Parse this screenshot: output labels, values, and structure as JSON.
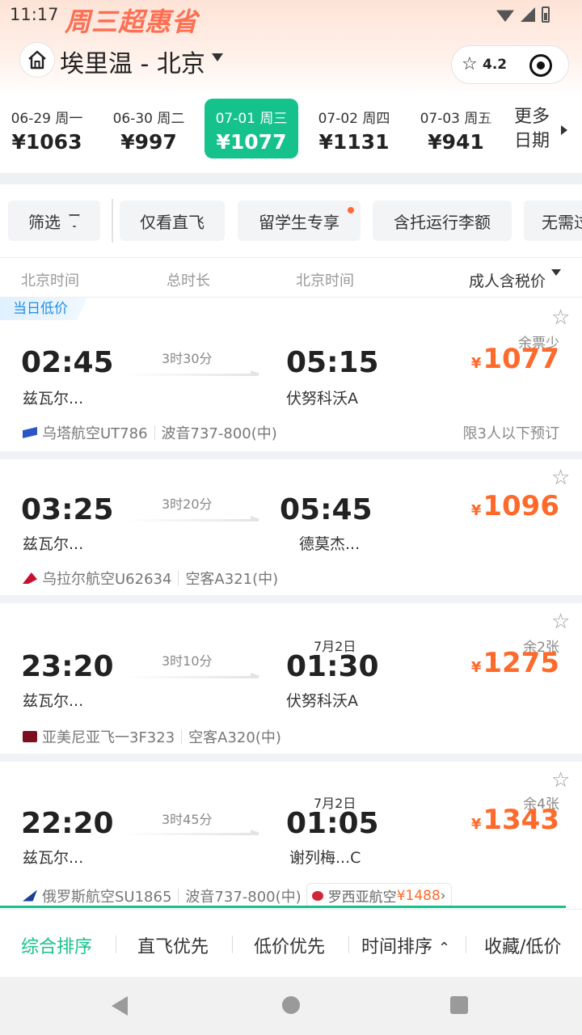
{
  "status": {
    "time": "11:17",
    "extra": "≠"
  },
  "promo": {
    "label": "周三超惠省"
  },
  "header": {
    "route": "埃里温 - 北京",
    "rating": "4.2"
  },
  "dates": [
    {
      "date": "06-29 周一",
      "price": "¥1063",
      "active": false
    },
    {
      "date": "06-30 周二",
      "price": "¥997",
      "active": false
    },
    {
      "date": "07-01 周三",
      "price": "¥1077",
      "active": true
    },
    {
      "date": "07-02 周四",
      "price": "¥1131",
      "active": false
    },
    {
      "date": "07-03 周五",
      "price": "¥941",
      "active": false
    }
  ],
  "more_dates": {
    "line1": "更多",
    "line2": "日期"
  },
  "filters": {
    "filter": "筛选",
    "direct": "仅看直飞",
    "student": "留学生专享",
    "baggage": "含托运行李额",
    "novisa": "无需过境签"
  },
  "columns": {
    "dep": "北京时间",
    "dur": "总时长",
    "arr": "北京时间",
    "price_sort": "成人含税价"
  },
  "flights": [
    {
      "tag": "当日低价",
      "dep_time": "02:45",
      "dep_airport": "兹瓦尔...",
      "duration": "3时30分",
      "arr_time": "05:15",
      "arr_day": "",
      "arr_airport": "伏努科沃A",
      "currency": "¥",
      "price": "1077",
      "remain": "余票少",
      "airline": "乌塔航空UT786",
      "aircraft": "波音737-800(中)",
      "note": "限3人以下预订",
      "logo_color": "#2a57c6"
    },
    {
      "tag": "",
      "dep_time": "03:25",
      "dep_airport": "兹瓦尔...",
      "duration": "3时20分",
      "arr_time": "05:45",
      "arr_day": "",
      "arr_airport": "德莫杰...",
      "currency": "¥",
      "price": "1096",
      "remain": "",
      "airline": "乌拉尔航空U62634",
      "aircraft": "空客A321(中)",
      "note": "",
      "logo_color": "#c8102e"
    },
    {
      "tag": "",
      "dep_time": "23:20",
      "dep_airport": "兹瓦尔...",
      "duration": "3时10分",
      "arr_time": "01:30",
      "arr_day": "7月2日",
      "arr_airport": "伏努科沃A",
      "currency": "¥",
      "price": "1275",
      "remain": "余2张",
      "airline": "亚美尼亚飞一3F323",
      "aircraft": "空客A320(中)",
      "note": "",
      "logo_color": "#7a1020"
    },
    {
      "tag": "",
      "dep_time": "22:20",
      "dep_airport": "兹瓦尔...",
      "duration": "3时45分",
      "arr_time": "01:05",
      "arr_day": "7月2日",
      "arr_airport": "谢列梅...C",
      "currency": "¥",
      "price": "1343",
      "remain": "余4张",
      "airline": "俄罗斯航空SU1865",
      "aircraft": "波音737-800(中)",
      "share_airline": "罗西亚航空",
      "share_price": "¥1488",
      "note": "",
      "logo_color": "#1b3f95"
    }
  ],
  "sortbar": {
    "comprehensive": "综合排序",
    "direct_first": "直飞优先",
    "low_price": "低价优先",
    "time_sort": "时间排序",
    "fav_low": "收藏/低价"
  }
}
